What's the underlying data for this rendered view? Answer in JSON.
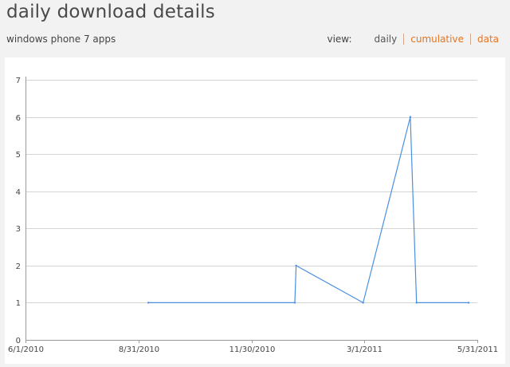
{
  "header": {
    "title": "daily download details",
    "subtitle": "windows phone 7 apps"
  },
  "view_switch": {
    "label": "view:",
    "options": [
      {
        "label": "daily",
        "active": false
      },
      {
        "label": "cumulative",
        "active": true
      },
      {
        "label": "data",
        "active": true
      }
    ]
  },
  "colors": {
    "accent": "#e8731e",
    "line": "#4a90e2",
    "grid": "#d4d4d4"
  },
  "chart_data": {
    "type": "line",
    "title": "",
    "xlabel": "",
    "ylabel": "",
    "x_ticks": [
      "6/1/2010",
      "8/31/2010",
      "11/30/2010",
      "3/1/2011",
      "5/31/2011"
    ],
    "y_ticks": [
      0,
      1,
      2,
      3,
      4,
      5,
      6,
      7
    ],
    "ylim": [
      0,
      7
    ],
    "xlim": [
      "2010-06-01",
      "2011-05-31"
    ],
    "grid": true,
    "series": [
      {
        "x": [
          "2010-09-08",
          "2011-01-04",
          "2011-01-05",
          "2011-02-28",
          "2011-04-07",
          "2011-04-12",
          "2011-05-24"
        ],
        "y": [
          1,
          1,
          2,
          1,
          6,
          1,
          1
        ]
      }
    ]
  }
}
